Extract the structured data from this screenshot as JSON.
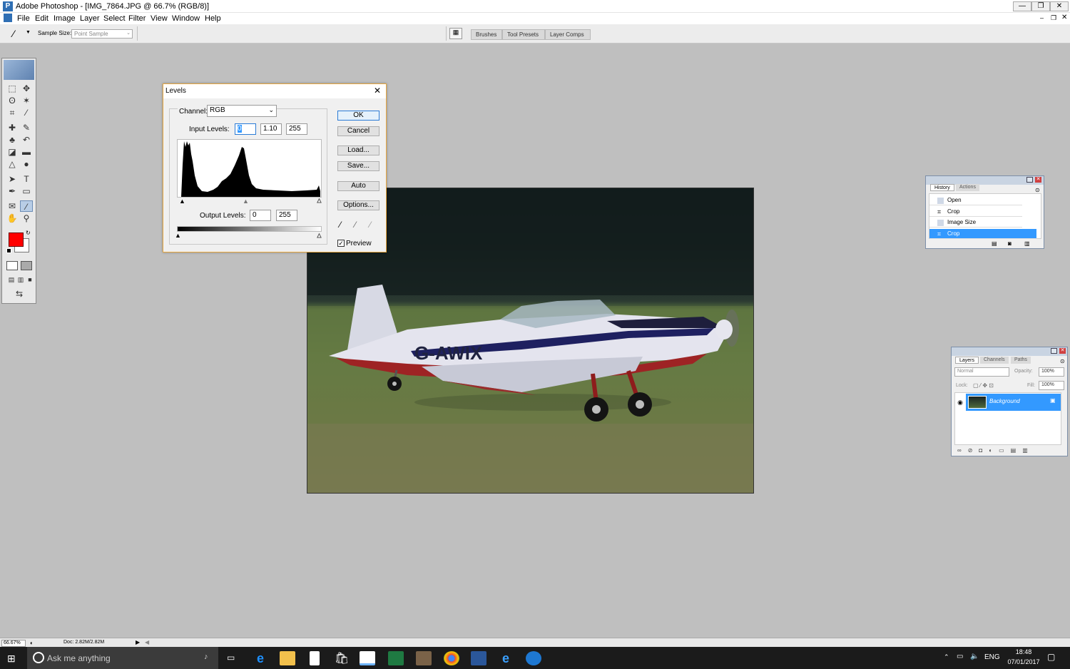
{
  "window": {
    "title": "Adobe Photoshop - [IMG_7864.JPG @ 66.7% (RGB/8)]",
    "app_icon": "photoshop-icon"
  },
  "menus": [
    "File",
    "Edit",
    "Image",
    "Layer",
    "Select",
    "Filter",
    "View",
    "Window",
    "Help"
  ],
  "options_bar": {
    "sample_size_label": "Sample Size:",
    "sample_size_value": "Point Sample"
  },
  "top_tabs": [
    "Brushes",
    "Tool Presets",
    "Layer Comps"
  ],
  "levels": {
    "title": "Levels",
    "channel_label": "Channel:",
    "channel_value": "RGB",
    "input_levels_label": "Input Levels:",
    "input_black": "0",
    "input_gamma": "1.10",
    "input_white": "255",
    "output_levels_label": "Output Levels:",
    "output_black": "0",
    "output_white": "255",
    "buttons": {
      "ok": "OK",
      "cancel": "Cancel",
      "load": "Load...",
      "save": "Save...",
      "auto": "Auto",
      "options": "Options..."
    },
    "preview_label": "Preview",
    "preview_checked": true
  },
  "photo": {
    "registration": "G-AWIX"
  },
  "history_panel": {
    "tabs": [
      "History",
      "Actions"
    ],
    "items": [
      "Open",
      "Crop",
      "Image Size",
      "Crop"
    ],
    "selected_index": 3
  },
  "layers_panel": {
    "tabs": [
      "Layers",
      "Channels",
      "Paths"
    ],
    "blend_mode": "Normal",
    "opacity_label": "Opacity:",
    "opacity": "100%",
    "lock_label": "Lock:",
    "fill_label": "Fill:",
    "fill": "100%",
    "layers": [
      "Background"
    ]
  },
  "status_bar": {
    "zoom": "66.67%",
    "doc": "Doc: 2.82M/2.82M"
  },
  "taskbar": {
    "search_placeholder": "Ask me anything",
    "language": "ENG",
    "time": "18:48",
    "date": "07/01/2017"
  },
  "colors": {
    "foreground": "#ff0000",
    "background": "#ffffff",
    "selection": "#3399ff"
  }
}
